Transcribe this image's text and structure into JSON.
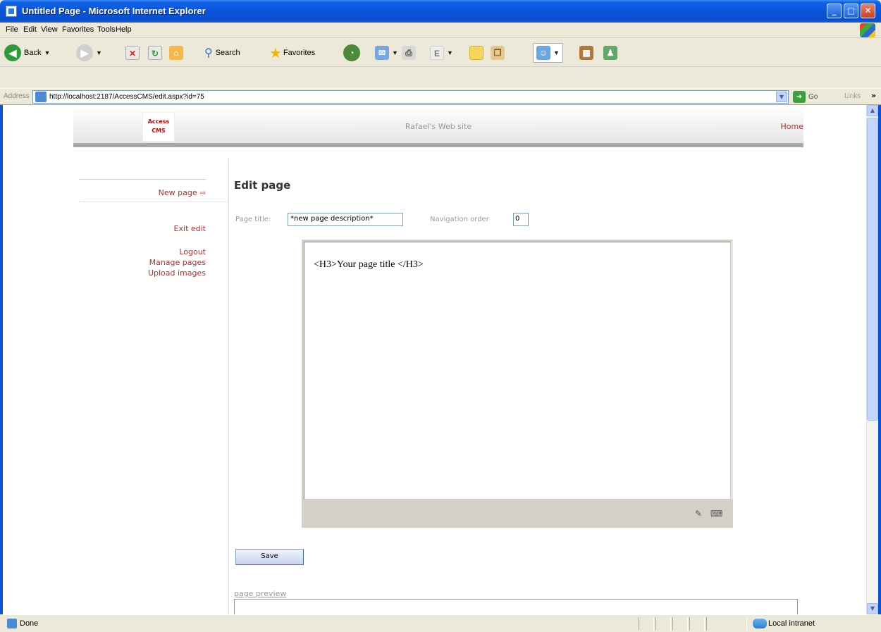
{
  "window": {
    "title": "Untitled Page - Microsoft Internet Explorer",
    "minimize": "_",
    "maximize": "□",
    "close": "✕"
  },
  "menu": [
    "File",
    "Edit",
    "View",
    "Favorites",
    "Tools",
    "Help"
  ],
  "toolbar": {
    "back_label": "Back",
    "search_label": "Search",
    "favorites_label": "Favorites"
  },
  "address": {
    "label": "Address",
    "url": "http://localhost:2187/AccessCMS/edit.aspx?id=75",
    "go_label": "Go",
    "links_label": "Links"
  },
  "site": {
    "logo_line1": "Access",
    "logo_line2": "CMS",
    "title": "Rafael's Web site",
    "home_link": "Home"
  },
  "sidebar": {
    "current_page": "New page",
    "current_arrow": "⇨",
    "exit_edit": "Exit edit",
    "links": [
      "Logout",
      "Manage pages",
      "Upload images"
    ]
  },
  "edit_form": {
    "heading": "Edit page",
    "page_title_label": "Page title:",
    "page_title_value": "*new page description*",
    "nav_order_label": "Navigation order",
    "nav_order_value": "0",
    "editor_content": "<H3>Your page title </H3>",
    "save_label": "Save",
    "preview_label": "page preview"
  },
  "status": {
    "text": "Done",
    "zone": "Local intranet"
  },
  "colors": {
    "link_red": "#b03030",
    "xp_blue": "#0a53d8",
    "chrome": "#ece9d8"
  }
}
